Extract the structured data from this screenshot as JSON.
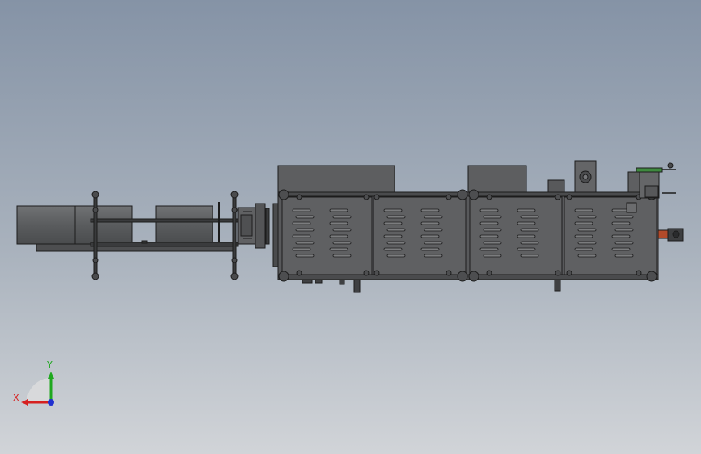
{
  "viewport": {
    "background_top": "#8593a6",
    "background_bottom": "#d1d4d8",
    "model_color": "#5b5c5e",
    "edge_color": "#1c1c1c",
    "accent_green": "#3f8a3f",
    "accent_red": "#b24a2a"
  },
  "triad": {
    "x_label": "X",
    "y_label": "Y",
    "x_color": "#d62020",
    "y_color": "#1fa81f",
    "z_color": "#2030d0"
  }
}
